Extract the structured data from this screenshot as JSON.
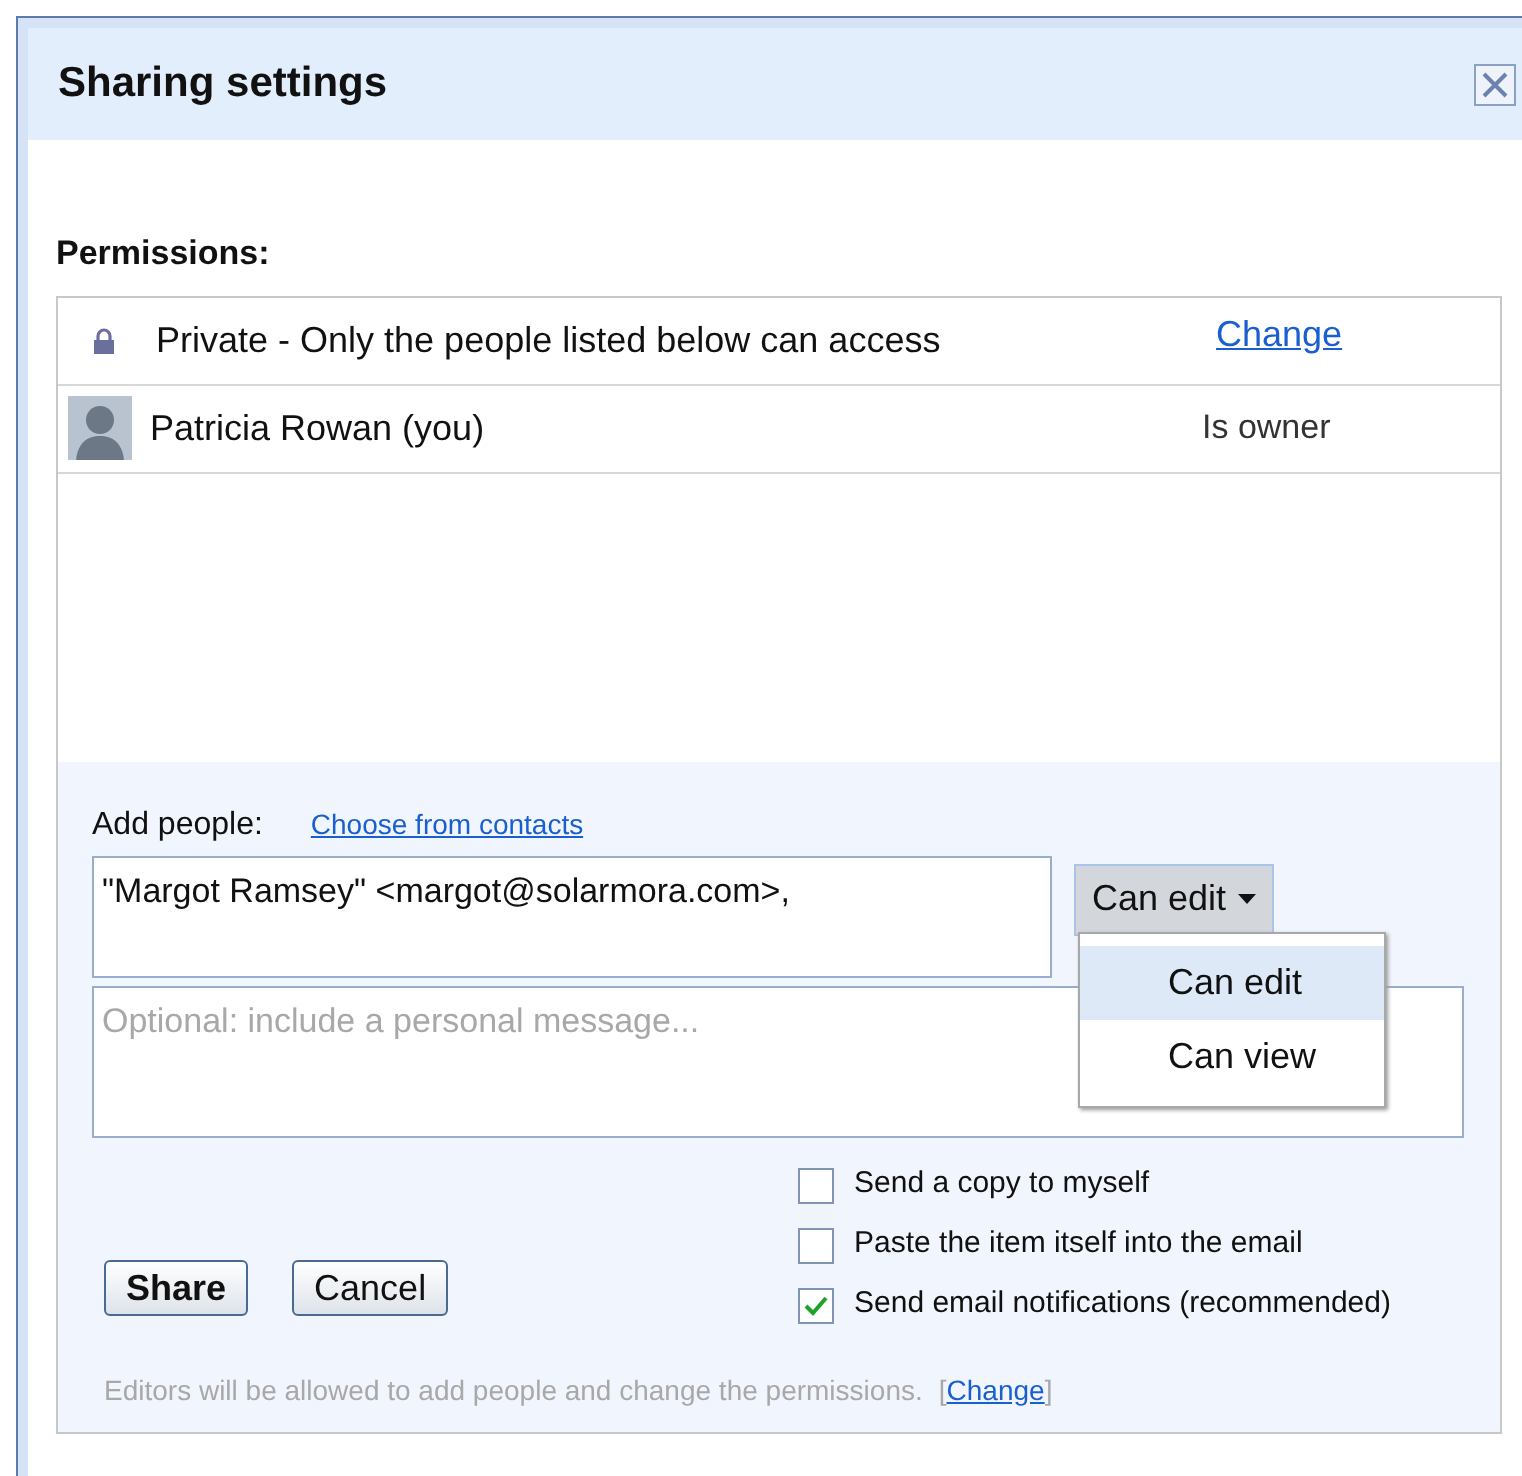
{
  "dialog": {
    "title": "Sharing settings"
  },
  "permissions": {
    "label": "Permissions:",
    "rows": [
      {
        "kind": "visibility",
        "text": "Private - Only the people listed below can access",
        "action": "Change"
      },
      {
        "kind": "person",
        "text": "Patricia Rowan (you)",
        "role": "Is owner"
      }
    ]
  },
  "add_people": {
    "label": "Add people:",
    "contacts_link": "Choose from contacts",
    "value": "\"Margot Ramsey\" <margot@solarmora.com>,",
    "message_placeholder": "Optional: include a personal message...",
    "access": {
      "label": "Can edit",
      "expanded": true,
      "options": [
        {
          "label": "Can edit",
          "selected": true
        },
        {
          "label": "Can view",
          "selected": false
        }
      ]
    }
  },
  "options": [
    {
      "label": "Send a copy to myself",
      "checked": false
    },
    {
      "label": "Paste the item itself into the email",
      "checked": false
    },
    {
      "label": "Send email notifications (recommended)",
      "checked": true
    }
  ],
  "buttons": [
    {
      "label": "Share",
      "primary": true
    },
    {
      "label": "Cancel",
      "primary": false
    }
  ],
  "footer": {
    "text": "Editors will be allowed to add people and change the permissions.",
    "open": "[",
    "link": "Change",
    "close": "]"
  }
}
